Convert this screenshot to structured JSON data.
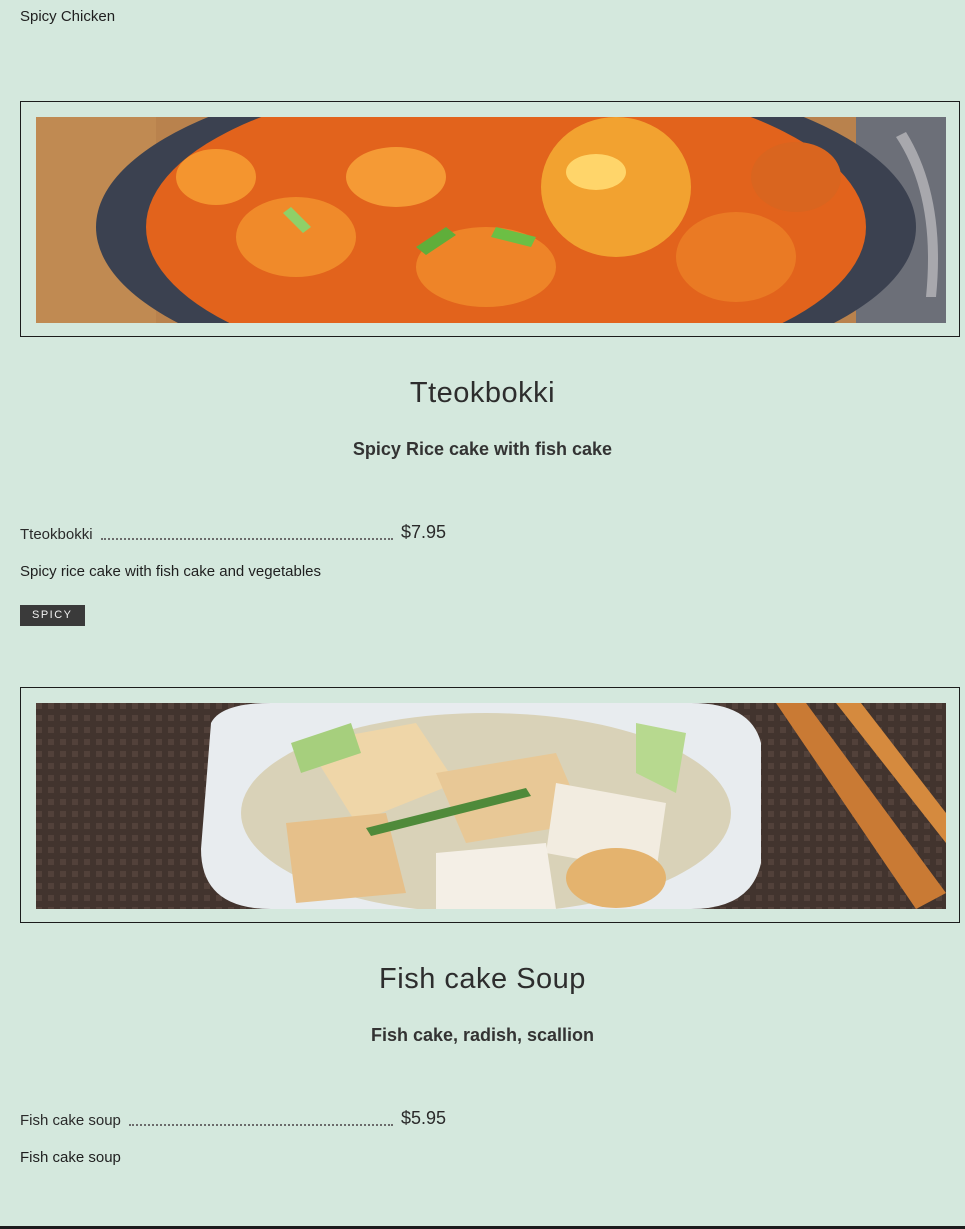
{
  "previous_item": {
    "description": "Spicy Chicken"
  },
  "sections": [
    {
      "title": "Tteokbokki",
      "subtitle": "Spicy Rice cake with fish cake",
      "item": {
        "name": "Tteokbokki",
        "price": "$7.95",
        "description": "Spicy rice cake with fish cake and vegetables",
        "badge": "SPICY"
      }
    },
    {
      "title": "Fish cake Soup",
      "subtitle": "Fish cake, radish, scallion",
      "item": {
        "name": "Fish cake soup",
        "price": "$5.95",
        "description": "Fish cake soup"
      }
    }
  ],
  "colors": {
    "background": "#d4e8dd",
    "badge": "#3a3a3a",
    "frame_border": "#1c1c1c"
  }
}
